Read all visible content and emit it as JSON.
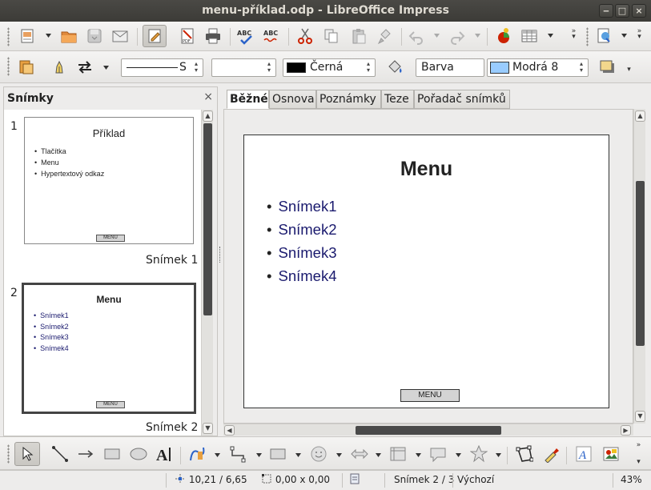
{
  "window": {
    "title": "menu-příklad.odp - LibreOffice Impress",
    "controls": [
      "minimize",
      "maximize",
      "close"
    ]
  },
  "standard_toolbar": {
    "icons": [
      "templates-icon",
      "open-icon",
      "save-icon",
      "email-icon",
      "edit-file-icon",
      "export-pdf-icon",
      "print-icon",
      "spellcheck-icon",
      "autospellcheck-icon",
      "cut-icon",
      "copy-icon",
      "paste-icon",
      "clone-formatting-icon",
      "undo-icon",
      "redo-icon",
      "chart-icon",
      "table-icon",
      "navigator-icon"
    ]
  },
  "line_fill_toolbar": {
    "line_style_value": "S",
    "line_width_value": "",
    "line_color_value": "Černá",
    "line_color_swatch": "#000000",
    "area_style_value": "Barva",
    "fill_color_value": "Modrá 8",
    "fill_color_swatch": "#99ccff",
    "shadow_swatch": "#f2d78c"
  },
  "slides_pane": {
    "title": "Snímky",
    "close": "×",
    "slides": [
      {
        "number": "1",
        "title": "Příklad",
        "bullets": [
          "Tlačítka",
          "Menu",
          "Hypertextový odkaz"
        ],
        "button": "MENU",
        "label": "Snímek 1"
      },
      {
        "number": "2",
        "title": "Menu",
        "bullets": [
          "Snímek1",
          "Snímek2",
          "Snímek3",
          "Snímek4"
        ],
        "button": "MENU",
        "label": "Snímek 2"
      }
    ]
  },
  "view_tabs": [
    "Běžné",
    "Osnova",
    "Poznámky",
    "Teze",
    "Pořadač snímků"
  ],
  "current_slide": {
    "title": "Menu",
    "bullets": [
      "Snímek1",
      "Snímek2",
      "Snímek3",
      "Snímek4"
    ],
    "button": "MENU",
    "link_color": "#1a1a6e"
  },
  "drawing_toolbar": {
    "icons": [
      "select-icon",
      "line-icon",
      "arrow-line-icon",
      "rectangle-icon",
      "ellipse-icon",
      "text-icon",
      "curve-icon",
      "connector-icon",
      "basic-shapes-icon",
      "symbol-shapes-icon",
      "block-arrows-icon",
      "flowchart-icon",
      "callouts-icon",
      "stars-icon",
      "points-icon",
      "glue-points-icon",
      "fontwork-icon",
      "insert-image-icon"
    ]
  },
  "status_bar": {
    "position": "10,21 / 6,65",
    "size": "0,00 x 0,00",
    "slide_info": "Snímek 2 / 3",
    "master": "Výchozí",
    "zoom": "43%"
  },
  "colors": {
    "titlebar": "#3c3b37",
    "scroll_thumb": "#4a4a4a",
    "accent_red": "#cc2200"
  }
}
